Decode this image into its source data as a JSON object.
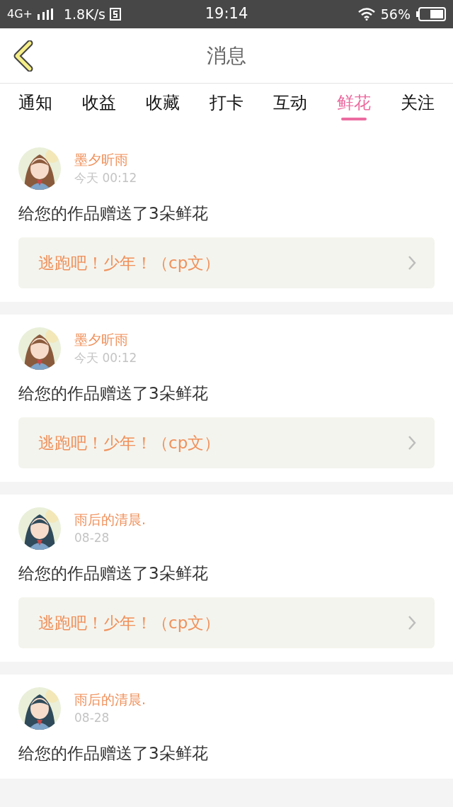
{
  "status_bar": {
    "network": "4G+",
    "speed": "1.8K/s",
    "time": "19:14",
    "battery": "56%"
  },
  "header": {
    "title": "消息"
  },
  "tabs": [
    {
      "label": "通知",
      "selected": false
    },
    {
      "label": "收益",
      "selected": false
    },
    {
      "label": "收藏",
      "selected": false
    },
    {
      "label": "打卡",
      "selected": false
    },
    {
      "label": "互动",
      "selected": false
    },
    {
      "label": "鲜花",
      "selected": true
    },
    {
      "label": "关注",
      "selected": false
    }
  ],
  "messages": [
    {
      "user": "墨夕昕雨",
      "time": "今天 00:12",
      "text": "给您的作品赠送了3朵鲜花",
      "work": "逃跑吧！少年！（cp文）"
    },
    {
      "user": "墨夕昕雨",
      "time": "今天 00:12",
      "text": "给您的作品赠送了3朵鲜花",
      "work": "逃跑吧！少年！（cp文）"
    },
    {
      "user": "雨后的清晨.",
      "time": "08-28",
      "text": "给您的作品赠送了3朵鲜花",
      "work": "逃跑吧！少年！（cp文）"
    },
    {
      "user": "雨后的清晨.",
      "time": "08-28",
      "text": "给您的作品赠送了3朵鲜花"
    }
  ]
}
